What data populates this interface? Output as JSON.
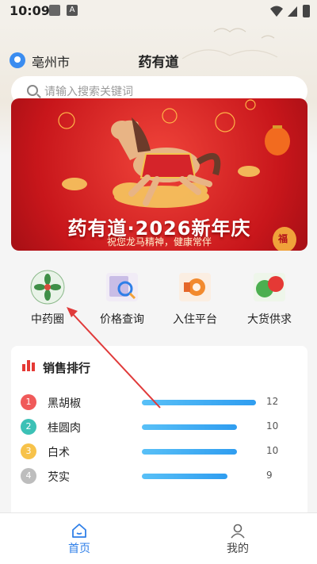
{
  "status_bar": {
    "time": "10:09",
    "icons": [
      "image-icon",
      "a-icon",
      "wifi-icon",
      "signal-icon",
      "battery-icon"
    ]
  },
  "header": {
    "city": "亳州市",
    "title": "药有道"
  },
  "search": {
    "placeholder": "请输入搜索关键词"
  },
  "banner": {
    "title": "药有道·2026新年庆",
    "subtitle": "祝您龙马精神，健康常伴",
    "badge": "福"
  },
  "quick_grid": [
    {
      "label": "中药圈",
      "icon": "herb-circle-icon"
    },
    {
      "label": "价格查询",
      "icon": "price-search-icon"
    },
    {
      "label": "入住平台",
      "icon": "megaphone-icon"
    },
    {
      "label": "大货供求",
      "icon": "supply-demand-icon"
    }
  ],
  "sales_ranking": {
    "title": "销售排行",
    "items": [
      {
        "rank": "1",
        "name": "黑胡椒",
        "value": 12,
        "value_label": "12",
        "color": "#f05a5a"
      },
      {
        "rank": "2",
        "name": "桂圆肉",
        "value": 10,
        "value_label": "10",
        "color": "#3cc1b6"
      },
      {
        "rank": "3",
        "name": "白术",
        "value": 10,
        "value_label": "10",
        "color": "#f7c24a"
      },
      {
        "rank": "4",
        "name": "芡实",
        "value": 9,
        "value_label": "9",
        "color": "#bdbdbd"
      }
    ]
  },
  "bottom_nav": [
    {
      "label": "首页",
      "icon": "home-icon",
      "active": true
    },
    {
      "label": "我的",
      "icon": "user-icon",
      "active": false
    }
  ],
  "colors": {
    "accent": "#2f7fe8",
    "bar": "#2f9df0",
    "banner": "#d21f24",
    "annotation": "#e03a3a"
  }
}
